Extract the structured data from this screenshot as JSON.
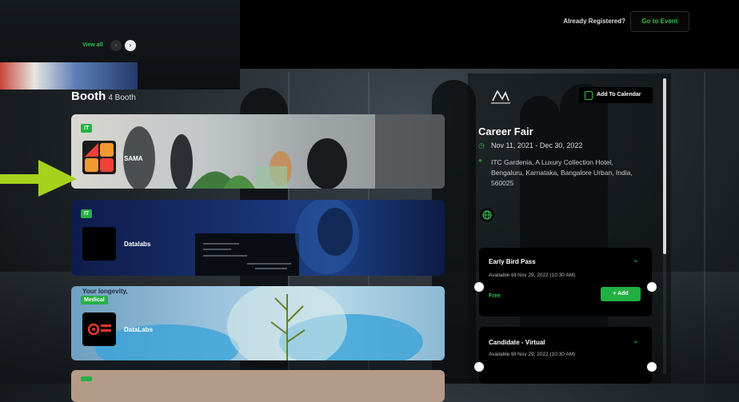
{
  "top_left": {
    "view_all": "View all",
    "prev_icon": "chevron-left-icon",
    "next_icon": "chevron-right-icon"
  },
  "header": {
    "already_registered": "Already Registered?",
    "go_to_event": "Go to Event"
  },
  "booth": {
    "title": "Booth",
    "count": "4 Booth",
    "cards": [
      {
        "tag": "IT",
        "name": "SAMA",
        "logo_icon": "sama-logo"
      },
      {
        "tag": "IT",
        "name": "Datalabs",
        "logo_icon": "datalabs-logo"
      },
      {
        "tag": "Medical",
        "name": "DataLabs",
        "logo_icon": "dato-labs-logo",
        "banner_text": "Your longevity, quality"
      },
      {
        "tag": "",
        "name": "",
        "logo_icon": ""
      }
    ]
  },
  "event": {
    "add_to_calendar": "Add To Calendar",
    "title": "Career Fair",
    "date": "Nov 11, 2021 - Dec 30, 2022",
    "location": "ITC Gardenia, A Luxury Collection Hotel, Bengaluru, Karnataka, Bangalore Urban, India, 560025",
    "tickets": [
      {
        "name": "Early Bird Pass",
        "available": "Available till Nov 29, 2022 (10:30 AM)",
        "price": "Free",
        "action": "+ Add"
      },
      {
        "name": "Candidate - Virtual",
        "available": "Available till Nov 29, 2022 (10:30 AM)"
      }
    ]
  },
  "colors": {
    "accent": "#2fc04a",
    "panel": "#000000"
  }
}
